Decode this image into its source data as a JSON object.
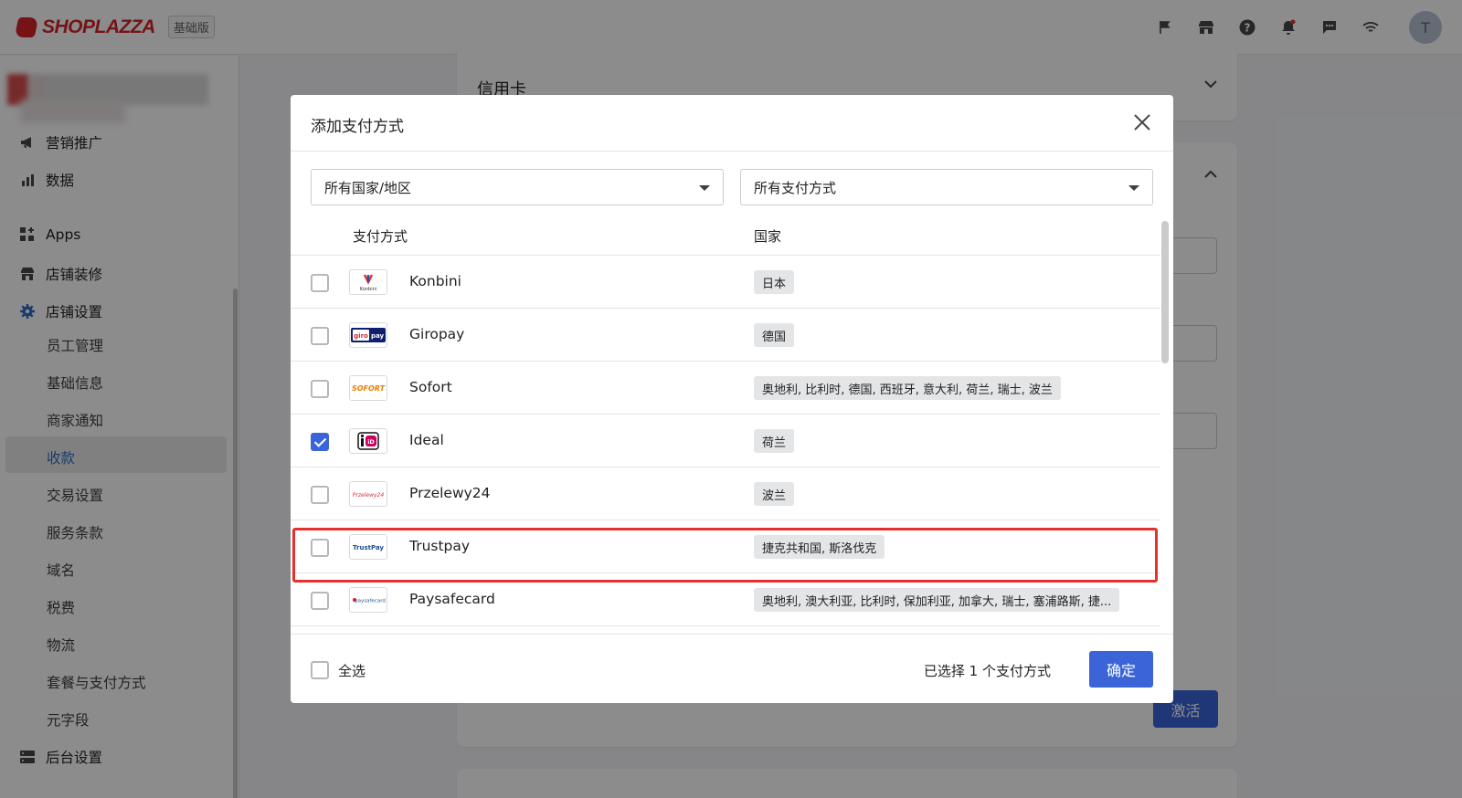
{
  "header": {
    "brand": "SHOPLAZZA",
    "plan_badge": "基础版",
    "avatar_initial": "T",
    "icons": [
      "flag-icon",
      "store-icon",
      "help-icon",
      "bell-icon",
      "chat-icon",
      "wifi-icon"
    ]
  },
  "sidebar": {
    "items": [
      {
        "label": "营销推广",
        "icon": "megaphone-icon"
      },
      {
        "label": "数据",
        "icon": "bar-chart-icon"
      },
      {
        "label": "Apps",
        "icon": "apps-icon"
      },
      {
        "label": "店铺装修",
        "icon": "store-icon"
      },
      {
        "label": "店铺设置",
        "icon": "gear-icon"
      }
    ],
    "sub_items": [
      "员工管理",
      "基础信息",
      "商家通知",
      "收款",
      "交易设置",
      "服务条款",
      "域名",
      "税费",
      "物流",
      "套餐与支付方式",
      "元字段"
    ],
    "active_sub": "收款",
    "bottom_item": {
      "label": "后台设置",
      "icon": "server-icon"
    }
  },
  "main": {
    "card_title": "信用卡",
    "activate_label": "激活"
  },
  "modal": {
    "title": "添加支付方式",
    "country_filter": "所有国家/地区",
    "method_filter": "所有支付方式",
    "columns": {
      "method": "支付方式",
      "country": "国家"
    },
    "rows": [
      {
        "name": "Konbini",
        "countries": "日本",
        "checked": false,
        "logo": "konbini-logo"
      },
      {
        "name": "Giropay",
        "countries": "德国",
        "checked": false,
        "logo": "giropay-logo"
      },
      {
        "name": "Sofort",
        "countries": "奥地利, 比利时, 德国, 西班牙, 意大利, 荷兰, 瑞士, 波兰",
        "checked": false,
        "logo": "sofort-logo"
      },
      {
        "name": "Ideal",
        "countries": "荷兰",
        "checked": true,
        "logo": "ideal-logo"
      },
      {
        "name": "Przelewy24",
        "countries": "波兰",
        "checked": false,
        "logo": "przelewy24-logo"
      },
      {
        "name": "Trustpay",
        "countries": "捷克共和国, 斯洛伐克",
        "checked": false,
        "logo": "trustpay-logo"
      },
      {
        "name": "Paysafecard",
        "countries": "奥地利, 澳大利亚, 比利时, 保加利亚, 加拿大, 瑞士, 塞浦路斯, 捷...",
        "checked": false,
        "logo": "paysafecard-logo"
      }
    ],
    "select_all_label": "全选",
    "selected_count": "已选择 1 个支付方式",
    "confirm_label": "确定",
    "logo_text": {
      "konbini": "Konbini",
      "giro": "giro",
      "pay": "pay",
      "sofort": "SOFORT",
      "ideal": "iD",
      "przelewy": "Przelewy24",
      "trustpay": "TrustPay",
      "paysafe": "paysafecard"
    }
  }
}
